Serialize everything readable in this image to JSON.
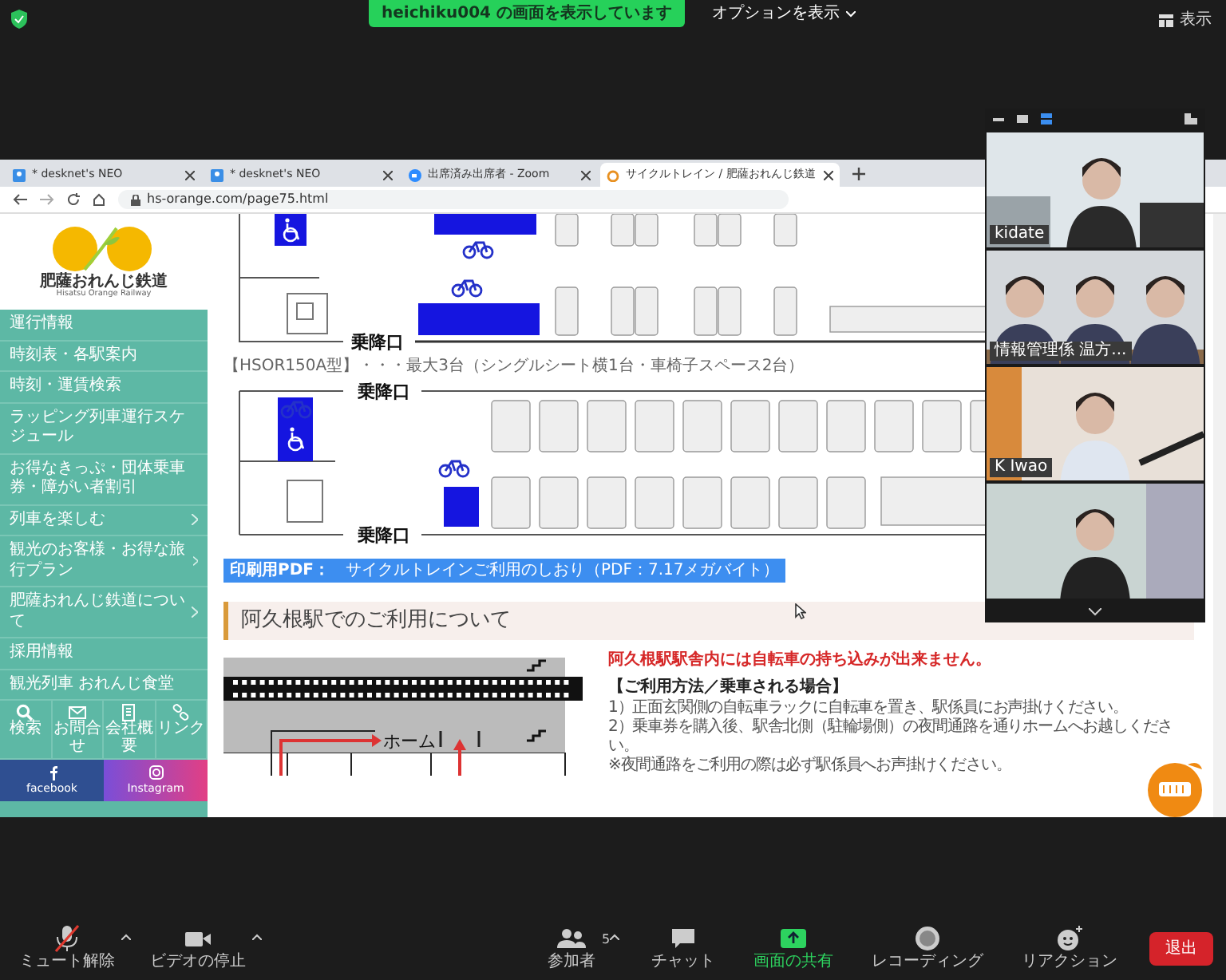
{
  "zoom_top": {
    "share_banner": "heichiku004 の画面を表示しています",
    "options_button": "オプションを表示",
    "view_button": "表示"
  },
  "browser": {
    "tabs": [
      {
        "label": "* desknet's NEO",
        "kind": "desknet",
        "selected": false
      },
      {
        "label": "* desknet's NEO",
        "kind": "desknet",
        "selected": false
      },
      {
        "label": "出席済み出席者 - Zoom",
        "kind": "zoom",
        "selected": false
      },
      {
        "label": "サイクルトレイン / 肥薩おれんじ鉄道",
        "kind": "orange",
        "selected": true
      }
    ],
    "url": "hs-orange.com/page75.html"
  },
  "site": {
    "logo_title": "肥薩おれんじ鉄道",
    "logo_subtitle": "Hisatsu Orange Railway",
    "menu": [
      {
        "label": "運行情報",
        "has_submenu": false
      },
      {
        "label": "時刻表・各駅案内",
        "has_submenu": false
      },
      {
        "label": "時刻・運賃検索",
        "has_submenu": false
      },
      {
        "label": "ラッピング列車運行スケジュール",
        "has_submenu": false
      },
      {
        "label": "お得なきっぷ・団体乗車券・障がい者割引",
        "has_submenu": false
      },
      {
        "label": "列車を楽しむ",
        "has_submenu": true
      },
      {
        "label": "観光のお客様・お得な旅行プラン",
        "has_submenu": true
      },
      {
        "label": "肥薩おれんじ鉄道について",
        "has_submenu": true
      },
      {
        "label": "採用情報",
        "has_submenu": false
      },
      {
        "label": "観光列車 おれんじ食堂",
        "has_submenu": false
      }
    ],
    "quick_links": [
      {
        "label": "検索",
        "kind": "search"
      },
      {
        "label": "お問合せ",
        "kind": "mail"
      },
      {
        "label": "会社概要",
        "kind": "building"
      },
      {
        "label": "リンク",
        "kind": "link"
      }
    ],
    "social": [
      {
        "label": "facebook",
        "kind": "facebook"
      },
      {
        "label": "Instagram",
        "kind": "instagram"
      }
    ]
  },
  "content": {
    "door_labels": [
      "乗降口",
      "乗降口",
      "乗降口"
    ],
    "caption": "【HSOR150A型】・・・最大3台（シングルシート横1台・車椅子スペース2台）",
    "pdf_prefix": "印刷用PDF：",
    "pdf_link": "サイクルトレインご利用のしおり（PDF：7.17メガバイト）",
    "heading": "阿久根駅でのご利用について",
    "platform_label": "ホーム",
    "warning": "阿久根駅駅舎内には自転車の持ち込みが出来ません。",
    "usage_title": "【ご利用方法／乗車される場合】",
    "steps": [
      "1）正面玄関側の自転車ラックに自転車を置き、駅係員にお声掛けください。",
      "2）乗車券を購入後、駅舎北側（駐輪場側）の夜間通路を通りホームへお越しください。",
      "※夜間通路をご利用の際は必ず駅係員へお声掛けください。"
    ]
  },
  "video": {
    "tiles": [
      {
        "name": "kidate",
        "kind": "single"
      },
      {
        "name": "情報管理係 温方...",
        "kind": "group"
      },
      {
        "name": "K Iwao",
        "kind": "single"
      },
      {
        "kind": "single"
      }
    ]
  },
  "toolbar": {
    "items": [
      {
        "label": "ミュート解除",
        "kind": "mic",
        "muted": true,
        "menu": true
      },
      {
        "label": "ビデオの停止",
        "kind": "video",
        "muted": false,
        "menu": true
      },
      {
        "label": "参加者",
        "kind": "people",
        "count": "5",
        "menu": true
      },
      {
        "label": "チャット",
        "kind": "chat"
      },
      {
        "label": "画面の共有",
        "kind": "share"
      },
      {
        "label": "レコーディング",
        "kind": "record"
      },
      {
        "label": "リアクション",
        "kind": "reaction"
      }
    ],
    "leave": "退出"
  }
}
